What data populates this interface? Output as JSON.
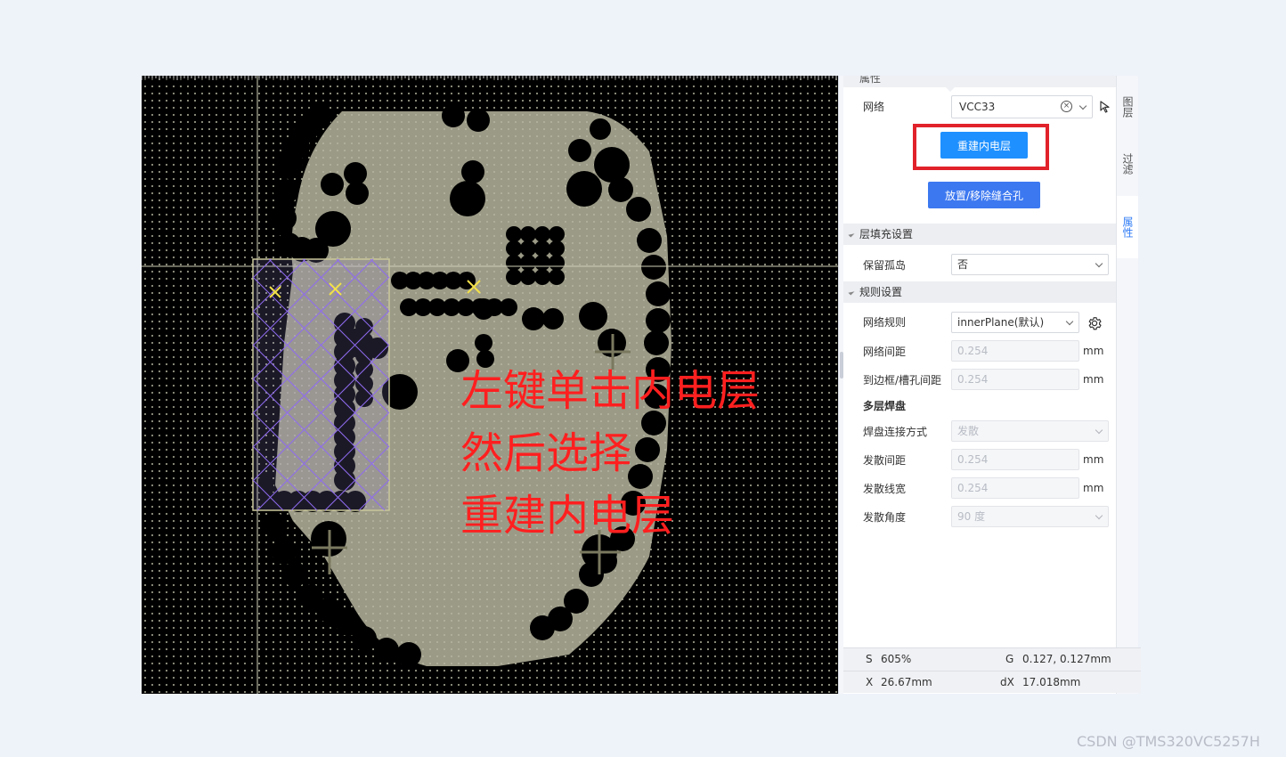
{
  "canvas": {
    "annotation": [
      "左键单击内电层",
      "然后选择",
      "重建内电层"
    ]
  },
  "panel": {
    "partial_section_title": "属性",
    "net_label": "网络",
    "net_value": "VCC33",
    "rebuild_button": "重建内电层",
    "stitch_button": "放置/移除缝合孔",
    "layer_fill_section": "层填充设置",
    "keep_island_label": "保留孤岛",
    "keep_island_value": "否",
    "rule_section": "规则设置",
    "net_rule_label": "网络规则",
    "net_rule_value": "innerPlane(默认)",
    "net_clearance_label": "网络间距",
    "net_clearance_value": "0.254",
    "edge_clearance_label": "到边框/槽孔间距",
    "edge_clearance_value": "0.254",
    "unit": "mm",
    "multilayer_pad_label": "多层焊盘",
    "pad_conn_label": "焊盘连接方式",
    "pad_conn_value": "发散",
    "spoke_clearance_label": "发散间距",
    "spoke_clearance_value": "0.254",
    "spoke_width_label": "发散线宽",
    "spoke_width_value": "0.254",
    "spoke_angle_label": "发散角度",
    "spoke_angle_value": "90 度"
  },
  "tabs": [
    {
      "label": "图层",
      "active": false
    },
    {
      "label": "过滤",
      "active": false
    },
    {
      "label": "属性",
      "active": true
    }
  ],
  "status": {
    "s_label": "S",
    "s_value": "605%",
    "g_label": "G",
    "g_value": "0.127, 0.127mm",
    "x_label": "X",
    "x_value": "26.67mm",
    "dx_label": "dX",
    "dx_value": "17.018mm"
  },
  "watermark": "CSDN @TMS320VC5257H",
  "colors": {
    "plane_fill": "#9b9a86",
    "annotation_red": "#ff1f1f",
    "highlight_box": "#e1222b",
    "primary_button": "#1e90ff",
    "secondary_button": "#3c78f0",
    "active_tab": "#2f7bf5",
    "hatch": "#8f6bf0"
  },
  "icons": [
    "clear-icon",
    "chevron-down-icon",
    "pick-cursor-icon",
    "gear-icon",
    "section-collapse-icon"
  ]
}
